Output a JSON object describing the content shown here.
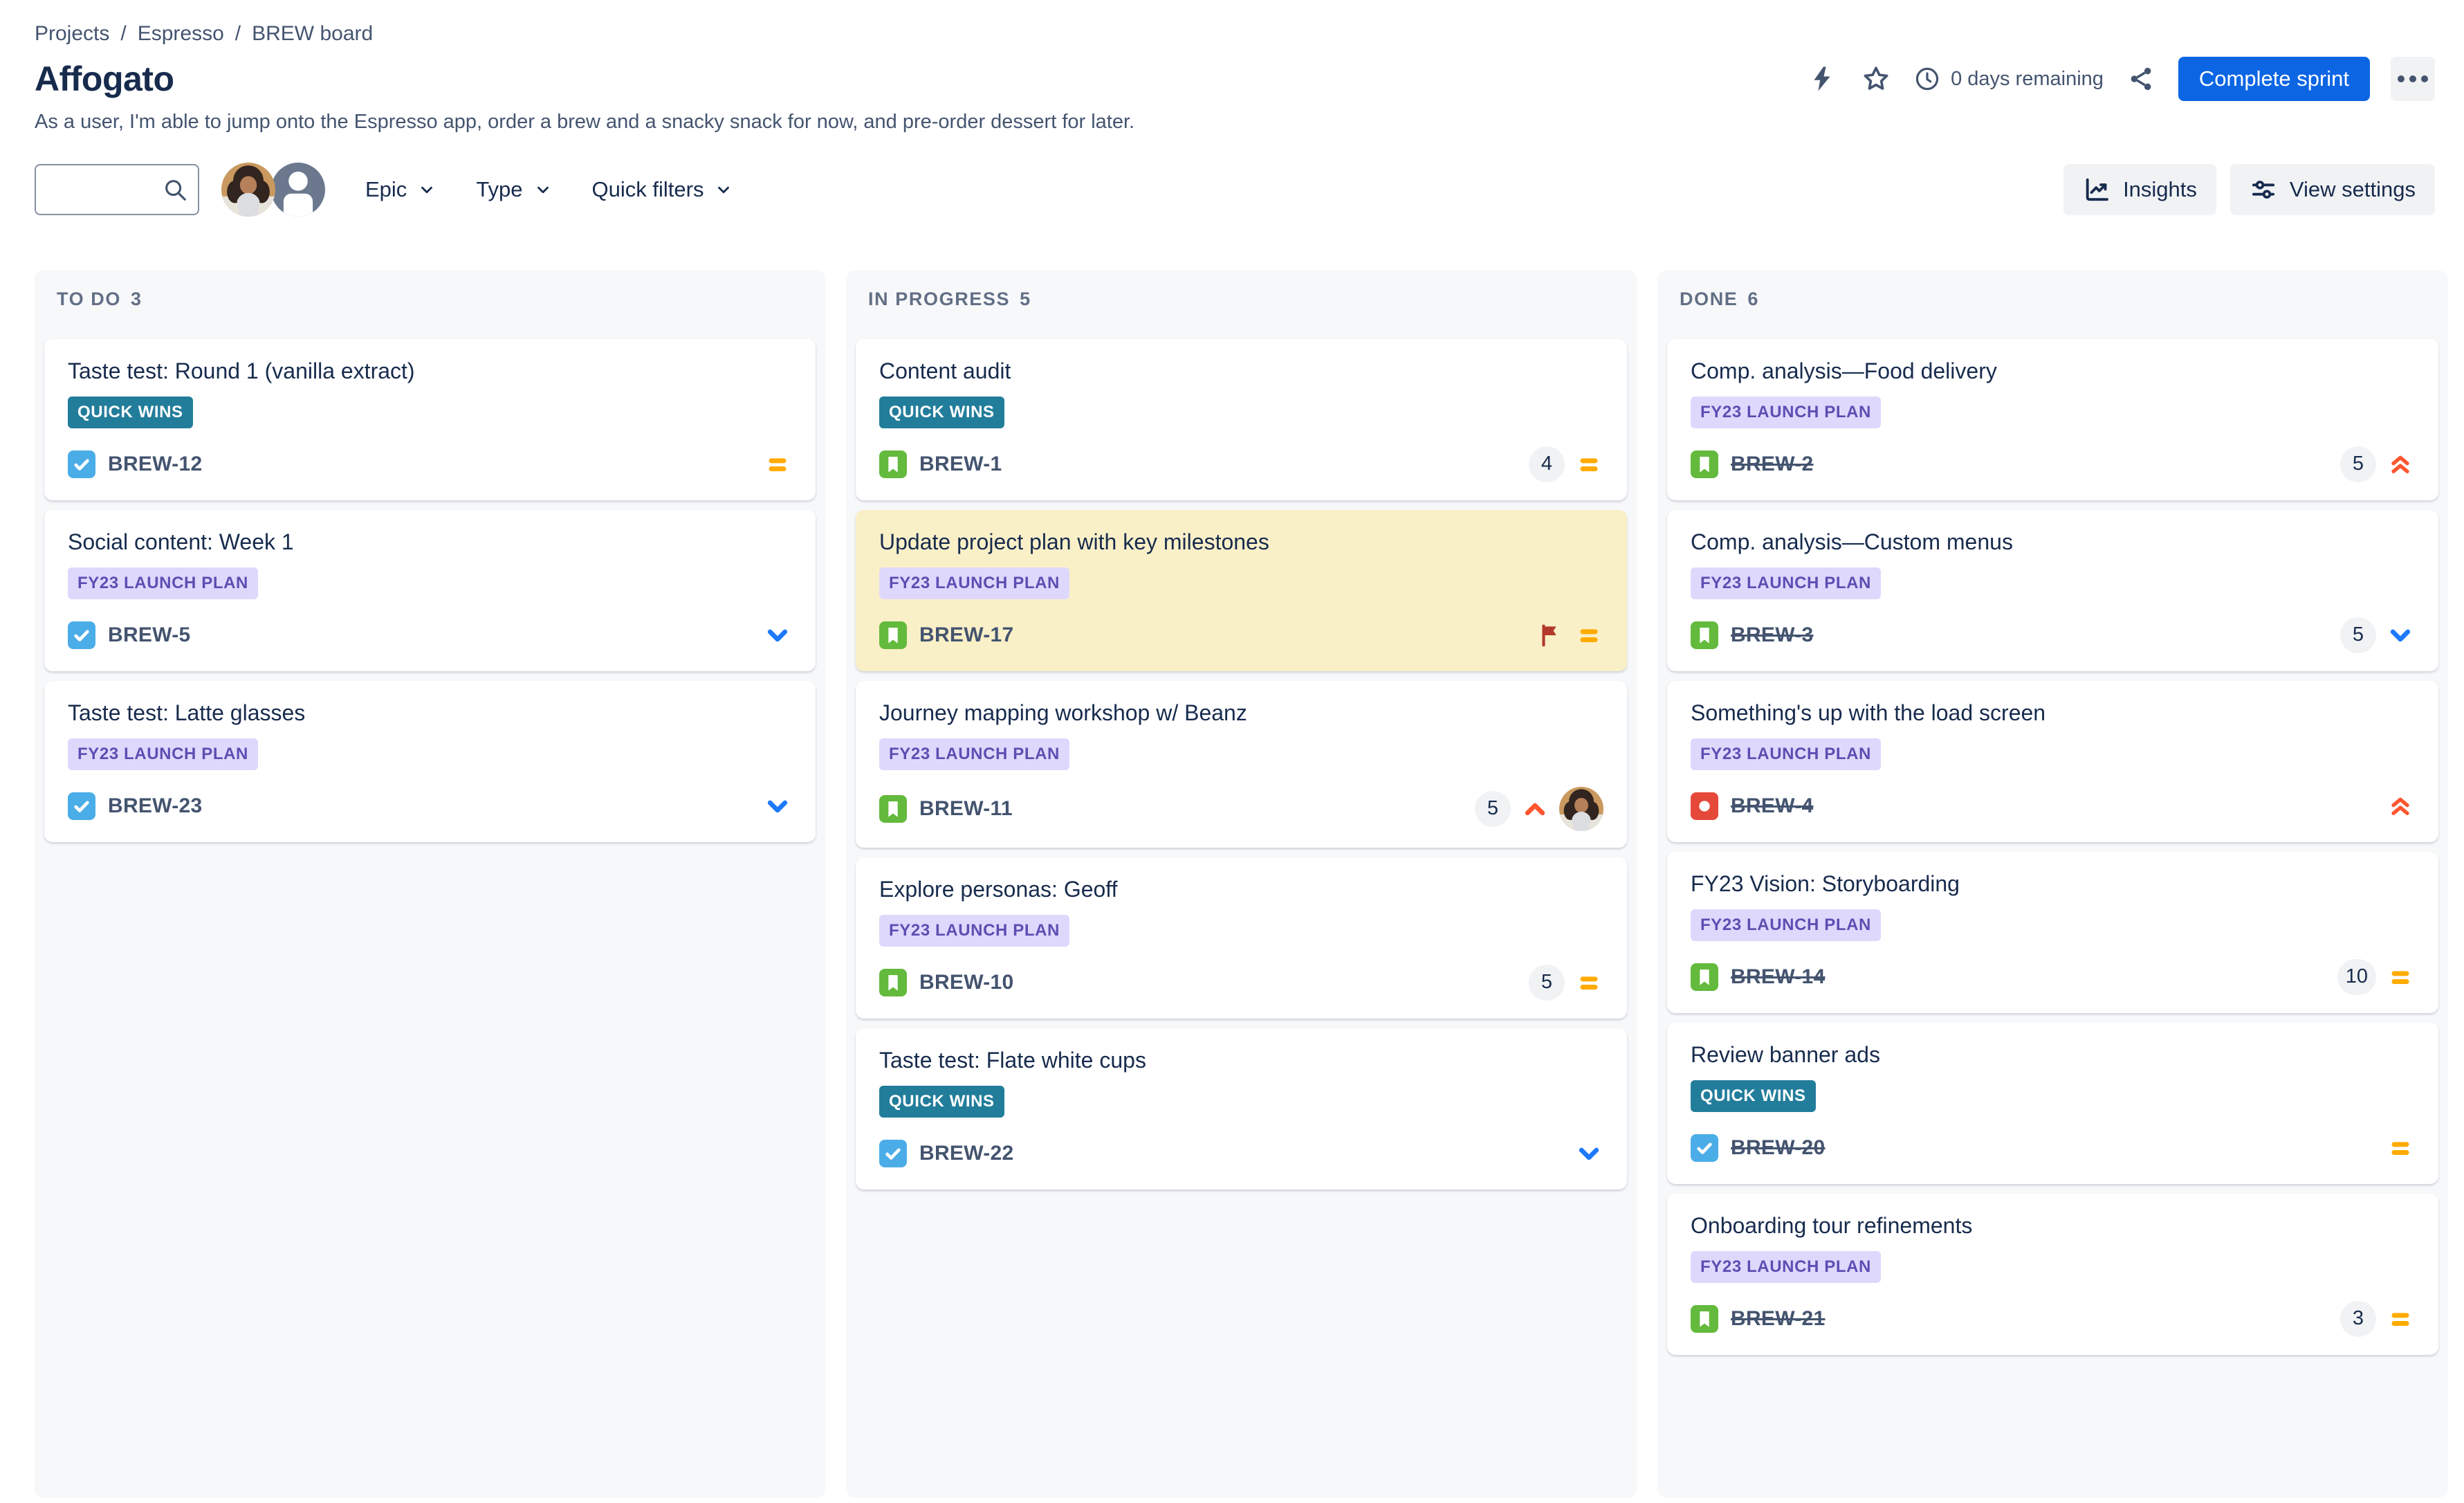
{
  "breadcrumb": {
    "separator": "/",
    "items": [
      "Projects",
      "Espresso",
      "BREW board"
    ]
  },
  "header": {
    "title": "Affogato",
    "description": "As a user, I'm able to jump onto the Espresso app, order a brew and a snacky snack for now, and pre-order dessert for later.",
    "days_remaining": "0 days remaining",
    "complete_sprint_label": "Complete sprint",
    "action_icons": [
      "lightning-icon",
      "star-icon",
      "clock-icon",
      "share-icon",
      "more-icon"
    ]
  },
  "toolbar": {
    "search_value": "",
    "filters": [
      {
        "label": "Epic"
      },
      {
        "label": "Type"
      },
      {
        "label": "Quick filters"
      }
    ],
    "insights_label": "Insights",
    "view_settings_label": "View settings"
  },
  "board": {
    "columns": [
      {
        "name": "TO DO",
        "count": "3",
        "cards": [
          {
            "key": "BREW-12",
            "title": "Taste test: Round 1 (vanilla extract)",
            "badge": {
              "label": "QUICK WINS",
              "style": "teal"
            },
            "type": "task",
            "points": null,
            "priority": "medium",
            "flagged": false,
            "done": false,
            "assignee_avatar": false
          },
          {
            "key": "BREW-5",
            "title": "Social content: Week 1",
            "badge": {
              "label": "FY23 LAUNCH PLAN",
              "style": "purple"
            },
            "type": "task",
            "points": null,
            "priority": "low",
            "flagged": false,
            "done": false,
            "assignee_avatar": false
          },
          {
            "key": "BREW-23",
            "title": "Taste test: Latte glasses",
            "badge": {
              "label": "FY23 LAUNCH PLAN",
              "style": "purple"
            },
            "type": "task",
            "points": null,
            "priority": "low",
            "flagged": false,
            "done": false,
            "assignee_avatar": false
          }
        ]
      },
      {
        "name": "IN PROGRESS",
        "count": "5",
        "cards": [
          {
            "key": "BREW-1",
            "title": "Content audit",
            "badge": {
              "label": "QUICK WINS",
              "style": "teal"
            },
            "type": "story",
            "points": "4",
            "priority": "medium",
            "flagged": false,
            "done": false,
            "assignee_avatar": false
          },
          {
            "key": "BREW-17",
            "title": "Update project plan with key milestones",
            "badge": {
              "label": "FY23 LAUNCH PLAN",
              "style": "purple"
            },
            "type": "story",
            "points": null,
            "priority": "medium",
            "flagged": true,
            "done": false,
            "assignee_avatar": false
          },
          {
            "key": "BREW-11",
            "title": "Journey mapping workshop w/ Beanz",
            "badge": {
              "label": "FY23 LAUNCH PLAN",
              "style": "purple"
            },
            "type": "story",
            "points": "5",
            "priority": "high",
            "flagged": false,
            "done": false,
            "assignee_avatar": true
          },
          {
            "key": "BREW-10",
            "title": "Explore personas: Geoff",
            "badge": {
              "label": "FY23 LAUNCH PLAN",
              "style": "purple"
            },
            "type": "story",
            "points": "5",
            "priority": "medium",
            "flagged": false,
            "done": false,
            "assignee_avatar": false
          },
          {
            "key": "BREW-22",
            "title": "Taste test: Flate white cups",
            "badge": {
              "label": "QUICK WINS",
              "style": "teal"
            },
            "type": "task",
            "points": null,
            "priority": "low",
            "flagged": false,
            "done": false,
            "assignee_avatar": false
          }
        ]
      },
      {
        "name": "DONE",
        "count": "6",
        "cards": [
          {
            "key": "BREW-2",
            "title": "Comp. analysis—Food delivery",
            "badge": {
              "label": "FY23 LAUNCH PLAN",
              "style": "purple"
            },
            "type": "story",
            "points": "5",
            "priority": "highest",
            "flagged": false,
            "done": true,
            "assignee_avatar": false
          },
          {
            "key": "BREW-3",
            "title": "Comp. analysis—Custom menus",
            "badge": {
              "label": "FY23 LAUNCH PLAN",
              "style": "purple"
            },
            "type": "story",
            "points": "5",
            "priority": "low",
            "flagged": false,
            "done": true,
            "assignee_avatar": false
          },
          {
            "key": "BREW-4",
            "title": "Something's up with the load screen",
            "badge": {
              "label": "FY23 LAUNCH PLAN",
              "style": "purple"
            },
            "type": "bug",
            "points": null,
            "priority": "highest",
            "flagged": false,
            "done": true,
            "assignee_avatar": false
          },
          {
            "key": "BREW-14",
            "title": "FY23 Vision: Storyboarding",
            "badge": {
              "label": "FY23 LAUNCH PLAN",
              "style": "purple"
            },
            "type": "story",
            "points": "10",
            "priority": "medium",
            "flagged": false,
            "done": true,
            "assignee_avatar": false
          },
          {
            "key": "BREW-20",
            "title": "Review banner ads",
            "badge": {
              "label": "QUICK WINS",
              "style": "teal"
            },
            "type": "task",
            "points": null,
            "priority": "medium",
            "flagged": false,
            "done": true,
            "assignee_avatar": false
          },
          {
            "key": "BREW-21",
            "title": "Onboarding tour refinements",
            "badge": {
              "label": "FY23 LAUNCH PLAN",
              "style": "purple"
            },
            "type": "story",
            "points": "3",
            "priority": "medium",
            "flagged": false,
            "done": true,
            "assignee_avatar": false
          }
        ]
      }
    ]
  },
  "colors": {
    "accent_blue": "#0C66E4",
    "column_bg": "#F7F8F9",
    "flagged_card_bg": "#FAF0C8",
    "text_primary": "#172B4D",
    "text_secondary": "#44546F",
    "column_header_text": "#626F86",
    "badge_teal_bg": "#227D9B",
    "badge_teal_text": "#FFFFFF",
    "badge_purple_bg": "#DFD8FD",
    "badge_purple_text": "#5E4DB2",
    "type_task": "#4BADE8",
    "type_story": "#63BA3C",
    "type_bug": "#E5493A",
    "priority_medium": "#FFAB00",
    "priority_low": "#1D7AFC",
    "priority_high": "#FF5630",
    "priority_highest": "#FF5630",
    "flag_red": "#B3392B",
    "icon_slate": "#44546F"
  }
}
